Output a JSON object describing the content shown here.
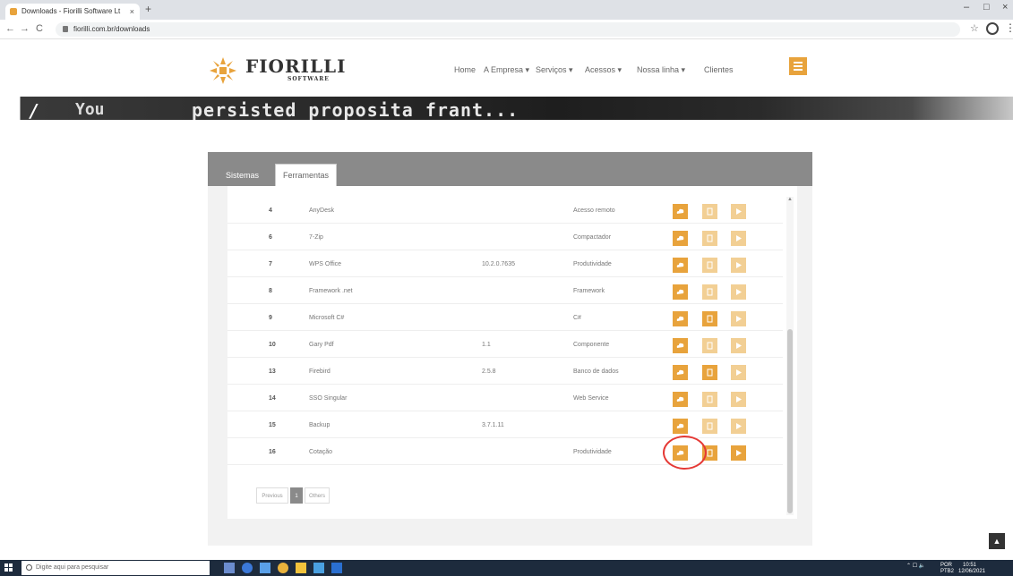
{
  "browser": {
    "tab_title": "Downloads - Fiorilli Software Lt",
    "tab_close": "×",
    "new_tab": "+",
    "url": "fiorilli.com.br/downloads",
    "back": "←",
    "forward": "→",
    "reload": "C",
    "bookmark": "☆",
    "menu": "⋮",
    "minimize": "–",
    "maximize": "□",
    "close": "×"
  },
  "site": {
    "logo_name": "FIORILLI",
    "logo_sub": "SOFTWARE",
    "nav": [
      {
        "label": "Home"
      },
      {
        "label": "A Empresa ▾"
      },
      {
        "label": "Serviços ▾"
      },
      {
        "label": "Acessos ▾"
      },
      {
        "label": "Nossa linha ▾"
      },
      {
        "label": "Clientes"
      }
    ],
    "accent_color": "#e8a33c"
  },
  "banner": {
    "left_text": "/ /",
    "mid_text": "You",
    "text": "persisted proposita frant..."
  },
  "panel": {
    "tabs": [
      {
        "label": "Sistemas",
        "active": false
      },
      {
        "label": "Ferramentas",
        "active": true
      }
    ],
    "rows": [
      {
        "id": "4",
        "name": "AnyDesk",
        "version": "",
        "category": "Acesso remoto",
        "light": [
          false,
          true,
          true
        ]
      },
      {
        "id": "6",
        "name": "7-Zip",
        "version": "",
        "category": "Compactador",
        "light": [
          false,
          true,
          true
        ]
      },
      {
        "id": "7",
        "name": "WPS Office",
        "version": "10.2.0.7635",
        "category": "Produtividade",
        "light": [
          false,
          true,
          true
        ]
      },
      {
        "id": "8",
        "name": "Framework .net",
        "version": "",
        "category": "Framework",
        "light": [
          false,
          true,
          true
        ]
      },
      {
        "id": "9",
        "name": "Microsoft C#",
        "version": "",
        "category": "C#",
        "light": [
          false,
          false,
          true
        ]
      },
      {
        "id": "10",
        "name": "Gary Pdf",
        "version": "1.1",
        "category": "Componente",
        "light": [
          false,
          true,
          true
        ]
      },
      {
        "id": "13",
        "name": "Firebird",
        "version": "2.5.8",
        "category": "Banco de dados",
        "light": [
          false,
          false,
          true
        ]
      },
      {
        "id": "14",
        "name": "SSO Singular",
        "version": "",
        "category": "Web Service",
        "light": [
          false,
          true,
          true
        ]
      },
      {
        "id": "15",
        "name": "Backup",
        "version": "3.7.1.11",
        "category": "",
        "light": [
          false,
          true,
          true
        ]
      },
      {
        "id": "16",
        "name": "Cotação",
        "version": "",
        "category": "Produtividade",
        "light": [
          false,
          false,
          false
        ]
      }
    ],
    "pagination": {
      "prev": "Previous",
      "current": "1",
      "next": "Others"
    },
    "scroll_up": "▲"
  },
  "back_to_top": "▲",
  "taskbar": {
    "search_placeholder": "Digite aqui para pesquisar",
    "lang": "POR",
    "lang2": "PTB2",
    "time": "10:51",
    "date": "12/06/2021"
  }
}
